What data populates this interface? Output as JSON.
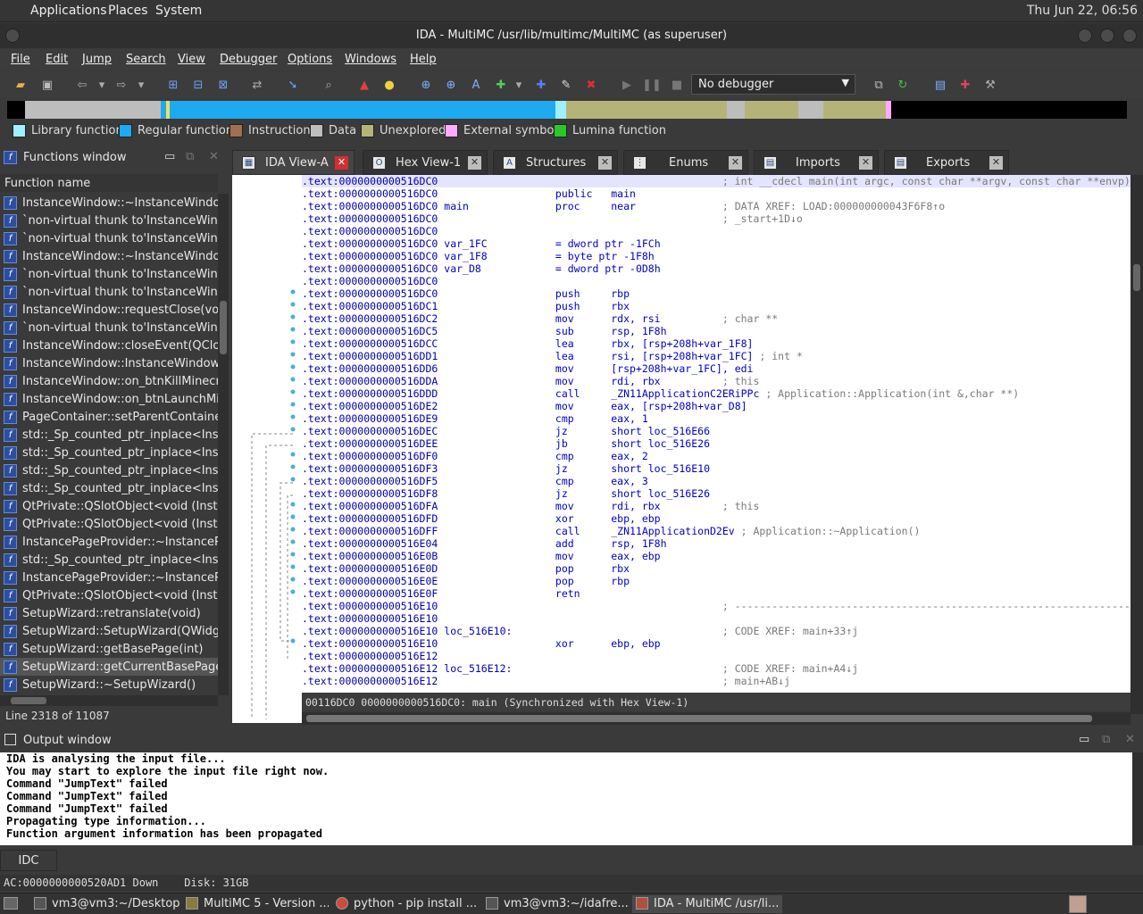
{
  "topbar": {
    "menus": [
      "Applications",
      "Places",
      "System"
    ],
    "clock": "Thu Jun 22, 06:56"
  },
  "window": {
    "title": "IDA - MultiMC /usr/lib/multimc/MultiMC (as superuser)"
  },
  "menubar": [
    "File",
    "Edit",
    "Jump",
    "Search",
    "View",
    "Debugger",
    "Options",
    "Windows",
    "Help"
  ],
  "toolbar": {
    "debugger_select": "No debugger"
  },
  "legend": [
    {
      "label": "Library function",
      "color": "#9ff0ff"
    },
    {
      "label": "Regular function",
      "color": "#1eaaf0"
    },
    {
      "label": "Instruction",
      "color": "#a07050"
    },
    {
      "label": "Data",
      "color": "#bdbdbd"
    },
    {
      "label": "Unexplored",
      "color": "#b4b478"
    },
    {
      "label": "External symbol",
      "color": "#ffaaff"
    },
    {
      "label": "Lumina function",
      "color": "#28c828"
    }
  ],
  "functions": {
    "title": "Functions window",
    "column": "Function name",
    "rows": [
      "InstanceWindow::~InstanceWindow()",
      "`non-virtual thunk to'InstanceWindow::~InstanceWindow()",
      "`non-virtual thunk to'InstanceWindow::~InstanceWindow()",
      "InstanceWindow::~InstanceWindow()",
      "`non-virtual thunk to'InstanceWindow::~InstanceWindow()",
      "`non-virtual thunk to'InstanceWindow::~InstanceWindow()",
      "InstanceWindow::requestClose(void)",
      "`non-virtual thunk to'InstanceWindow::requestClose(void)",
      "InstanceWindow::closeEvent(QCloseEvent *)",
      "InstanceWindow::InstanceWindow(std::shared_ptr<BaseInstance>)",
      "InstanceWindow::on_btnKillMinecraft_clicked(void)",
      "InstanceWindow::on_btnLaunchMinecraftOffline_clicked(void)",
      "PageContainer::setParentContainer(BasePageContainer *)",
      "std::_Sp_counted_ptr_inplace<InstancePageProvider>",
      "std::_Sp_counted_ptr_inplace<InstancePageProvider>",
      "std::_Sp_counted_ptr_inplace<InstancePageProvider>",
      "std::_Sp_counted_ptr_inplace<InstancePageProvider>",
      "QtPrivate::QSlotObject<void (InstanceWindow::*)(void)>",
      "QtPrivate::QSlotObject<void (InstanceWindow::*)(void)>",
      "InstancePageProvider::~InstancePageProvider()",
      "std::_Sp_counted_ptr_inplace<InstancePageProvider>",
      "InstancePageProvider::~InstancePageProvider()",
      "QtPrivate::QSlotObject<void (InstanceWindow::*)(void)>",
      "SetupWizard::retranslate(void)",
      "SetupWizard::SetupWizard(QWidget *)",
      "SetupWizard::getBasePage(int)",
      "SetupWizard::getCurrentBasePage(void)",
      "SetupWizard::~SetupWizard()"
    ],
    "selected_index": 26,
    "status": "Line 2318 of 11087"
  },
  "tabs": [
    {
      "label": "IDA View-A",
      "icon": "graph-icon",
      "active": true
    },
    {
      "label": "Hex View-1",
      "icon": "hex-icon",
      "active": false
    },
    {
      "label": "Structures",
      "icon": "struct-icon",
      "active": false
    },
    {
      "label": "Enums",
      "icon": "enum-icon",
      "active": false
    },
    {
      "label": "Imports",
      "icon": "import-icon",
      "active": false
    },
    {
      "label": "Exports",
      "icon": "export-icon",
      "active": false
    }
  ],
  "disasm": [
    {
      "addr": ".text:0000000000516DC0",
      "label": "",
      "mn": "",
      "op": "",
      "cmt": "; int __cdecl main(int argc, const char **argv, const char **envp)",
      "hl": true
    },
    {
      "addr": ".text:0000000000516DC0",
      "label": "",
      "mn": "public",
      "op": "main",
      "cmt": ""
    },
    {
      "addr": ".text:0000000000516DC0",
      "label": "main",
      "mn": "proc",
      "op": "near",
      "cmt": "; DATA XREF: LOAD:000000000043F6F8↑o"
    },
    {
      "addr": ".text:0000000000516DC0",
      "label": "",
      "mn": "",
      "op": "",
      "cmt": "; _start+1D↓o"
    },
    {
      "addr": ".text:0000000000516DC0",
      "label": "",
      "mn": "",
      "op": "",
      "cmt": ""
    },
    {
      "addr": ".text:0000000000516DC0",
      "label": "var_1FC",
      "mn": "= dword ptr",
      "op": "-1FCh",
      "cmt": ""
    },
    {
      "addr": ".text:0000000000516DC0",
      "label": "var_1F8",
      "mn": "= byte ptr",
      "op": "-1F8h",
      "cmt": ""
    },
    {
      "addr": ".text:0000000000516DC0",
      "label": "var_D8",
      "mn": "= dword ptr",
      "op": "-0D8h",
      "cmt": ""
    },
    {
      "addr": ".text:0000000000516DC0",
      "label": "",
      "mn": "",
      "op": "",
      "cmt": ""
    },
    {
      "addr": ".text:0000000000516DC0",
      "label": "",
      "mn": "push",
      "op": "rbp",
      "cmt": ""
    },
    {
      "addr": ".text:0000000000516DC1",
      "label": "",
      "mn": "push",
      "op": "rbx",
      "cmt": ""
    },
    {
      "addr": ".text:0000000000516DC2",
      "label": "",
      "mn": "mov",
      "op": "rdx, rsi",
      "cmt": "; char **"
    },
    {
      "addr": ".text:0000000000516DC5",
      "label": "",
      "mn": "sub",
      "op": "rsp, 1F8h",
      "cmt": ""
    },
    {
      "addr": ".text:0000000000516DCC",
      "label": "",
      "mn": "lea",
      "op": "rbx, [rsp+208h+var_1F8]",
      "cmt": ""
    },
    {
      "addr": ".text:0000000000516DD1",
      "label": "",
      "mn": "lea",
      "op": "rsi, [rsp+208h+var_1FC]",
      "cmt": "; int *"
    },
    {
      "addr": ".text:0000000000516DD6",
      "label": "",
      "mn": "mov",
      "op": "[rsp+208h+var_1FC], edi",
      "cmt": ""
    },
    {
      "addr": ".text:0000000000516DDA",
      "label": "",
      "mn": "mov",
      "op": "rdi, rbx",
      "cmt": "; this"
    },
    {
      "addr": ".text:0000000000516DDD",
      "label": "",
      "mn": "call",
      "op": "_ZN11ApplicationC2ERiPPc",
      "cmt": "; Application::Application(int &,char **)"
    },
    {
      "addr": ".text:0000000000516DE2",
      "label": "",
      "mn": "mov",
      "op": "eax, [rsp+208h+var_D8]",
      "cmt": ""
    },
    {
      "addr": ".text:0000000000516DE9",
      "label": "",
      "mn": "cmp",
      "op": "eax, 1",
      "cmt": ""
    },
    {
      "addr": ".text:0000000000516DEC",
      "label": "",
      "mn": "jz",
      "op": "short loc_516E66",
      "cmt": ""
    },
    {
      "addr": ".text:0000000000516DEE",
      "label": "",
      "mn": "jb",
      "op": "short loc_516E26",
      "cmt": ""
    },
    {
      "addr": ".text:0000000000516DF0",
      "label": "",
      "mn": "cmp",
      "op": "eax, 2",
      "cmt": ""
    },
    {
      "addr": ".text:0000000000516DF3",
      "label": "",
      "mn": "jz",
      "op": "short loc_516E10",
      "cmt": ""
    },
    {
      "addr": ".text:0000000000516DF5",
      "label": "",
      "mn": "cmp",
      "op": "eax, 3",
      "cmt": ""
    },
    {
      "addr": ".text:0000000000516DF8",
      "label": "",
      "mn": "jz",
      "op": "short loc_516E26",
      "cmt": ""
    },
    {
      "addr": ".text:0000000000516DFA",
      "label": "",
      "mn": "mov",
      "op": "rdi, rbx",
      "cmt": "; this"
    },
    {
      "addr": ".text:0000000000516DFD",
      "label": "",
      "mn": "xor",
      "op": "ebp, ebp",
      "cmt": ""
    },
    {
      "addr": ".text:0000000000516DFF",
      "label": "",
      "mn": "call",
      "op": "_ZN11ApplicationD2Ev",
      "cmt": "; Application::~Application()"
    },
    {
      "addr": ".text:0000000000516E04",
      "label": "",
      "mn": "add",
      "op": "rsp, 1F8h",
      "cmt": ""
    },
    {
      "addr": ".text:0000000000516E0B",
      "label": "",
      "mn": "mov",
      "op": "eax, ebp",
      "cmt": ""
    },
    {
      "addr": ".text:0000000000516E0D",
      "label": "",
      "mn": "pop",
      "op": "rbx",
      "cmt": ""
    },
    {
      "addr": ".text:0000000000516E0E",
      "label": "",
      "mn": "pop",
      "op": "rbp",
      "cmt": ""
    },
    {
      "addr": ".text:0000000000516E0F",
      "label": "",
      "mn": "retn",
      "op": "",
      "cmt": ""
    },
    {
      "addr": ".text:0000000000516E10",
      "label": "",
      "mn": "",
      "op": "",
      "cmt": "; ---------------------------------------------------------------------------"
    },
    {
      "addr": ".text:0000000000516E10",
      "label": "",
      "mn": "",
      "op": "",
      "cmt": ""
    },
    {
      "addr": ".text:0000000000516E10",
      "label": "loc_516E10:",
      "mn": "",
      "op": "",
      "cmt": "; CODE XREF: main+33↑j"
    },
    {
      "addr": ".text:0000000000516E10",
      "label": "",
      "mn": "xor",
      "op": "ebp, ebp",
      "cmt": ""
    },
    {
      "addr": ".text:0000000000516E12",
      "label": "",
      "mn": "",
      "op": "",
      "cmt": ""
    },
    {
      "addr": ".text:0000000000516E12",
      "label": "loc_516E12:",
      "mn": "",
      "op": "",
      "cmt": "; CODE XREF: main+A4↓j"
    },
    {
      "addr": ".text:0000000000516E12",
      "label": "",
      "mn": "",
      "op": "",
      "cmt": "; main+AB↓j"
    }
  ],
  "disasm_status": "00116DC0 0000000000516DC0: main (Synchronized with Hex View-1)",
  "output": {
    "title": "Output window",
    "lines": [
      "IDA is analysing the input file...",
      "You may start to explore the input file right now.",
      "Command \"JumpText\" failed",
      "Command \"JumpText\" failed",
      "Command \"JumpText\" failed",
      "Propagating type information...",
      "Function argument information has been propagated"
    ]
  },
  "idc_label": "IDC",
  "status_bar": "AC:0000000000520AD1 Down    Disk: 31GB",
  "taskbar": [
    {
      "label": "vm3@vm3:~/Desktop",
      "active": false
    },
    {
      "label": "MultiMC 5 - Version ...",
      "active": false
    },
    {
      "label": "python - pip install ...",
      "active": false
    },
    {
      "label": "vm3@vm3:~/idafre...",
      "active": false
    },
    {
      "label": "IDA - MultiMC /usr/li...",
      "active": true
    }
  ]
}
